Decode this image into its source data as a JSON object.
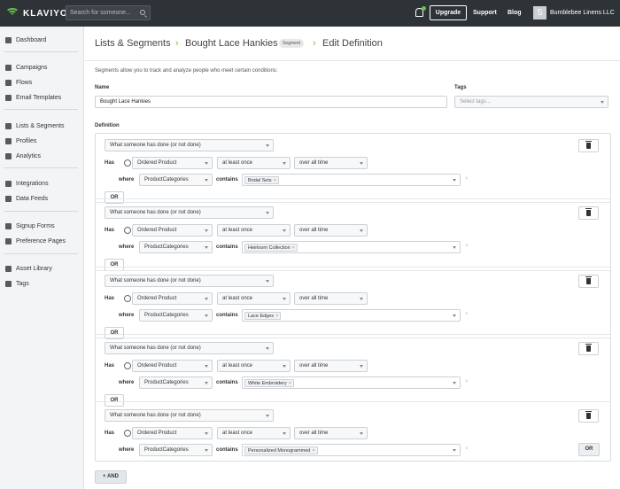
{
  "topbar": {
    "logo_text": "KLAVIYO",
    "search_placeholder": "Search for someone...",
    "upgrade_label": "Upgrade",
    "support_label": "Support",
    "blog_label": "Blog",
    "avatar_letter": "S",
    "account_name": "Bumblebee Linens LLC"
  },
  "sidebar": {
    "items": [
      {
        "label": "Dashboard",
        "icon": "home-icon"
      },
      {
        "label": "Campaigns",
        "icon": "paper-plane-icon"
      },
      {
        "label": "Flows",
        "icon": "flow-icon"
      },
      {
        "label": "Email Templates",
        "icon": "template-icon"
      },
      {
        "label": "Lists & Segments",
        "icon": "users-icon"
      },
      {
        "label": "Profiles",
        "icon": "user-icon"
      },
      {
        "label": "Analytics",
        "icon": "chart-icon"
      },
      {
        "label": "Integrations",
        "icon": "integrations-icon"
      },
      {
        "label": "Data Feeds",
        "icon": "data-feed-icon"
      },
      {
        "label": "Signup Forms",
        "icon": "form-icon"
      },
      {
        "label": "Preference Pages",
        "icon": "preferences-icon"
      },
      {
        "label": "Asset Library",
        "icon": "image-icon"
      },
      {
        "label": "Tags",
        "icon": "tag-icon"
      }
    ]
  },
  "header": {
    "crumb1": "Lists & Segments",
    "crumb2": "Bought Lace Hankies",
    "badge": "Segment",
    "crumb3": "Edit Definition"
  },
  "intro": "Segments allow you to track and analyze people who meet certain conditions:",
  "form": {
    "name_label": "Name",
    "name_value": "Bought Lace Hankies",
    "tags_label": "Tags",
    "tags_placeholder": "Select tags...",
    "definition_label": "Definition"
  },
  "conditions": {
    "condition_type": "What someone has done (or not done)",
    "has_label": "Has",
    "metric": "Ordered Product",
    "frequency": "at least once",
    "timeframe": "over all time",
    "where_label": "where",
    "property": "ProductCategories",
    "operator": "contains",
    "remove_x": "×",
    "or_label": "OR",
    "groups": [
      {
        "value": "Bridal Sets"
      },
      {
        "value": "Heirloom Collection"
      },
      {
        "value": "Lace Edges"
      },
      {
        "value": "White Embroidery"
      },
      {
        "value": "Personalized Monogrammed"
      }
    ]
  },
  "and_label": "+ AND"
}
